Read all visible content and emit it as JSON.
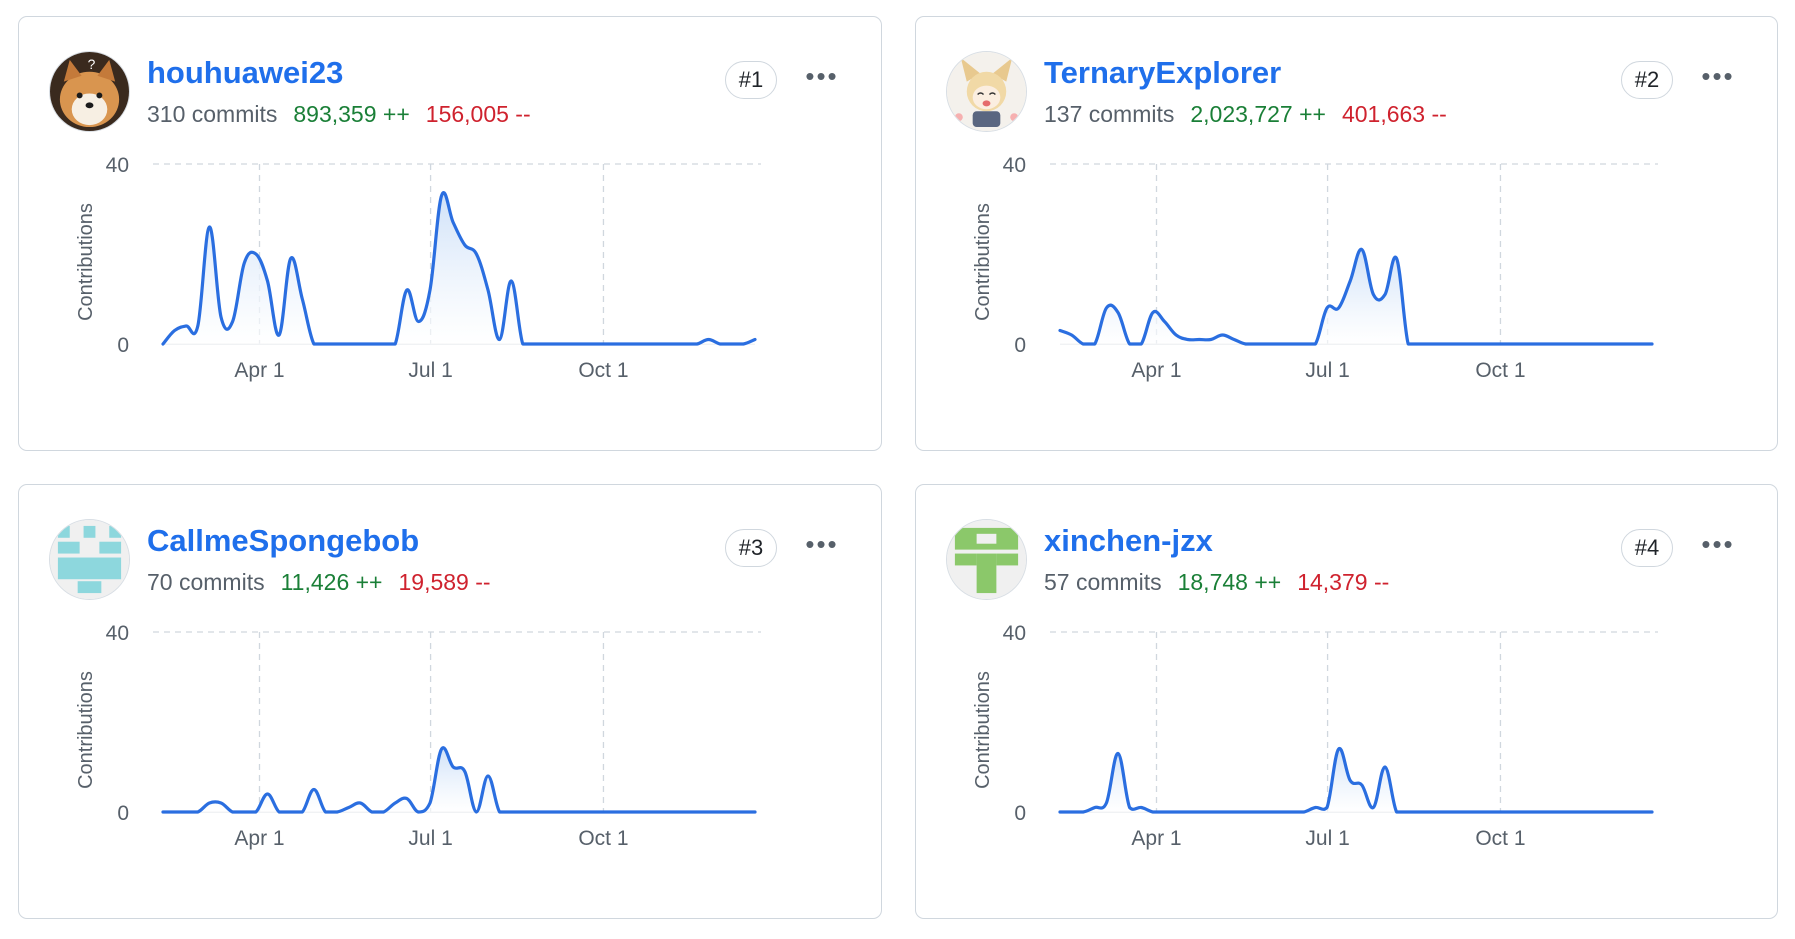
{
  "contributors": [
    {
      "rank": "#1",
      "username": "houhuawei23",
      "commits": "310 commits",
      "additions": "893,359 ++",
      "deletions": "156,005 --",
      "avatar_icon": "shiba-dog-avatar-icon",
      "chart_data": {
        "type": "area",
        "ylabel": "Contributions",
        "ylim": [
          0,
          40
        ],
        "y_ticks": [
          "0",
          "40"
        ],
        "x_ticks": [
          "Apr 1",
          "Jul 1",
          "Oct 1"
        ],
        "grid": true,
        "x_week": [
          0,
          1,
          2,
          3,
          4,
          5,
          6,
          7,
          8,
          9,
          10,
          11,
          12,
          13,
          14,
          15,
          16,
          17,
          18,
          19,
          20,
          21,
          22,
          23,
          24,
          25,
          26,
          27,
          28,
          29,
          30,
          31,
          32,
          33,
          34,
          35,
          36,
          37,
          38,
          39,
          40,
          41,
          42,
          43,
          44,
          45,
          46,
          47,
          48,
          49,
          50,
          51
        ],
        "values": [
          0,
          3,
          4,
          4,
          26,
          6,
          5,
          18,
          20,
          14,
          2,
          19,
          10,
          0,
          0,
          0,
          0,
          0,
          0,
          0,
          0,
          12,
          5,
          12,
          33,
          27,
          22,
          20,
          12,
          1,
          14,
          0,
          0,
          0,
          0,
          0,
          0,
          0,
          0,
          0,
          0,
          0,
          0,
          0,
          0,
          0,
          0,
          1,
          0,
          0,
          0,
          1
        ]
      }
    },
    {
      "rank": "#2",
      "username": "TernaryExplorer",
      "commits": "137 commits",
      "additions": "2,023,727 ++",
      "deletions": "401,663 --",
      "avatar_icon": "anime-fox-girl-avatar-icon",
      "chart_data": {
        "type": "area",
        "ylabel": "Contributions",
        "ylim": [
          0,
          40
        ],
        "y_ticks": [
          "0",
          "40"
        ],
        "x_ticks": [
          "Apr 1",
          "Jul 1",
          "Oct 1"
        ],
        "grid": true,
        "x_week": [
          0,
          1,
          2,
          3,
          4,
          5,
          6,
          7,
          8,
          9,
          10,
          11,
          12,
          13,
          14,
          15,
          16,
          17,
          18,
          19,
          20,
          21,
          22,
          23,
          24,
          25,
          26,
          27,
          28,
          29,
          30,
          31,
          32,
          33,
          34,
          35,
          36,
          37,
          38,
          39,
          40,
          41,
          42,
          43,
          44,
          45,
          46,
          47,
          48,
          49,
          50,
          51
        ],
        "values": [
          3,
          2,
          0,
          0,
          8,
          7,
          0,
          0,
          7,
          5,
          2,
          1,
          1,
          1,
          2,
          1,
          0,
          0,
          0,
          0,
          0,
          0,
          0,
          8,
          8,
          14,
          21,
          11,
          11,
          19,
          0,
          0,
          0,
          0,
          0,
          0,
          0,
          0,
          0,
          0,
          0,
          0,
          0,
          0,
          0,
          0,
          0,
          0,
          0,
          0,
          0,
          0
        ]
      }
    },
    {
      "rank": "#3",
      "username": "CallmeSpongebob",
      "commits": "70 commits",
      "additions": "11,426 ++",
      "deletions": "19,589 --",
      "avatar_icon": "cyan-pixel-identicon-icon",
      "chart_data": {
        "type": "area",
        "ylabel": "Contributions",
        "ylim": [
          0,
          40
        ],
        "y_ticks": [
          "0",
          "40"
        ],
        "x_ticks": [
          "Apr 1",
          "Jul 1",
          "Oct 1"
        ],
        "grid": true,
        "x_week": [
          0,
          1,
          2,
          3,
          4,
          5,
          6,
          7,
          8,
          9,
          10,
          11,
          12,
          13,
          14,
          15,
          16,
          17,
          18,
          19,
          20,
          21,
          22,
          23,
          24,
          25,
          26,
          27,
          28,
          29,
          30,
          31,
          32,
          33,
          34,
          35,
          36,
          37,
          38,
          39,
          40,
          41,
          42,
          43,
          44,
          45,
          46,
          47,
          48,
          49,
          50,
          51
        ],
        "values": [
          0,
          0,
          0,
          0,
          2,
          2,
          0,
          0,
          0,
          4,
          0,
          0,
          0,
          5,
          0,
          0,
          1,
          2,
          0,
          0,
          2,
          3,
          0,
          2,
          14,
          10,
          9,
          0,
          8,
          0,
          0,
          0,
          0,
          0,
          0,
          0,
          0,
          0,
          0,
          0,
          0,
          0,
          0,
          0,
          0,
          0,
          0,
          0,
          0,
          0,
          0,
          0
        ]
      }
    },
    {
      "rank": "#4",
      "username": "xinchen-jzx",
      "commits": "57 commits",
      "additions": "18,748 ++",
      "deletions": "14,379 --",
      "avatar_icon": "green-pixel-identicon-icon",
      "chart_data": {
        "type": "area",
        "ylabel": "Contributions",
        "ylim": [
          0,
          40
        ],
        "y_ticks": [
          "0",
          "40"
        ],
        "x_ticks": [
          "Apr 1",
          "Jul 1",
          "Oct 1"
        ],
        "grid": true,
        "x_week": [
          0,
          1,
          2,
          3,
          4,
          5,
          6,
          7,
          8,
          9,
          10,
          11,
          12,
          13,
          14,
          15,
          16,
          17,
          18,
          19,
          20,
          21,
          22,
          23,
          24,
          25,
          26,
          27,
          28,
          29,
          30,
          31,
          32,
          33,
          34,
          35,
          36,
          37,
          38,
          39,
          40,
          41,
          42,
          43,
          44,
          45,
          46,
          47,
          48,
          49,
          50,
          51
        ],
        "values": [
          0,
          0,
          0,
          1,
          2,
          13,
          1,
          1,
          0,
          0,
          0,
          0,
          0,
          0,
          0,
          0,
          0,
          0,
          0,
          0,
          0,
          0,
          1,
          1,
          14,
          7,
          6,
          1,
          10,
          0,
          0,
          0,
          0,
          0,
          0,
          0,
          0,
          0,
          0,
          0,
          0,
          0,
          0,
          0,
          0,
          0,
          0,
          0,
          0,
          0,
          0,
          0
        ]
      }
    }
  ],
  "more_menu_label": "•••",
  "colors": {
    "line": "#2a6ee0",
    "area_top": "#cfe1f8",
    "username": "#1f6feb",
    "additions": "#1a7f37",
    "deletions": "#cf222e",
    "grid": "#d0d7de",
    "border": "#d0d7de"
  }
}
